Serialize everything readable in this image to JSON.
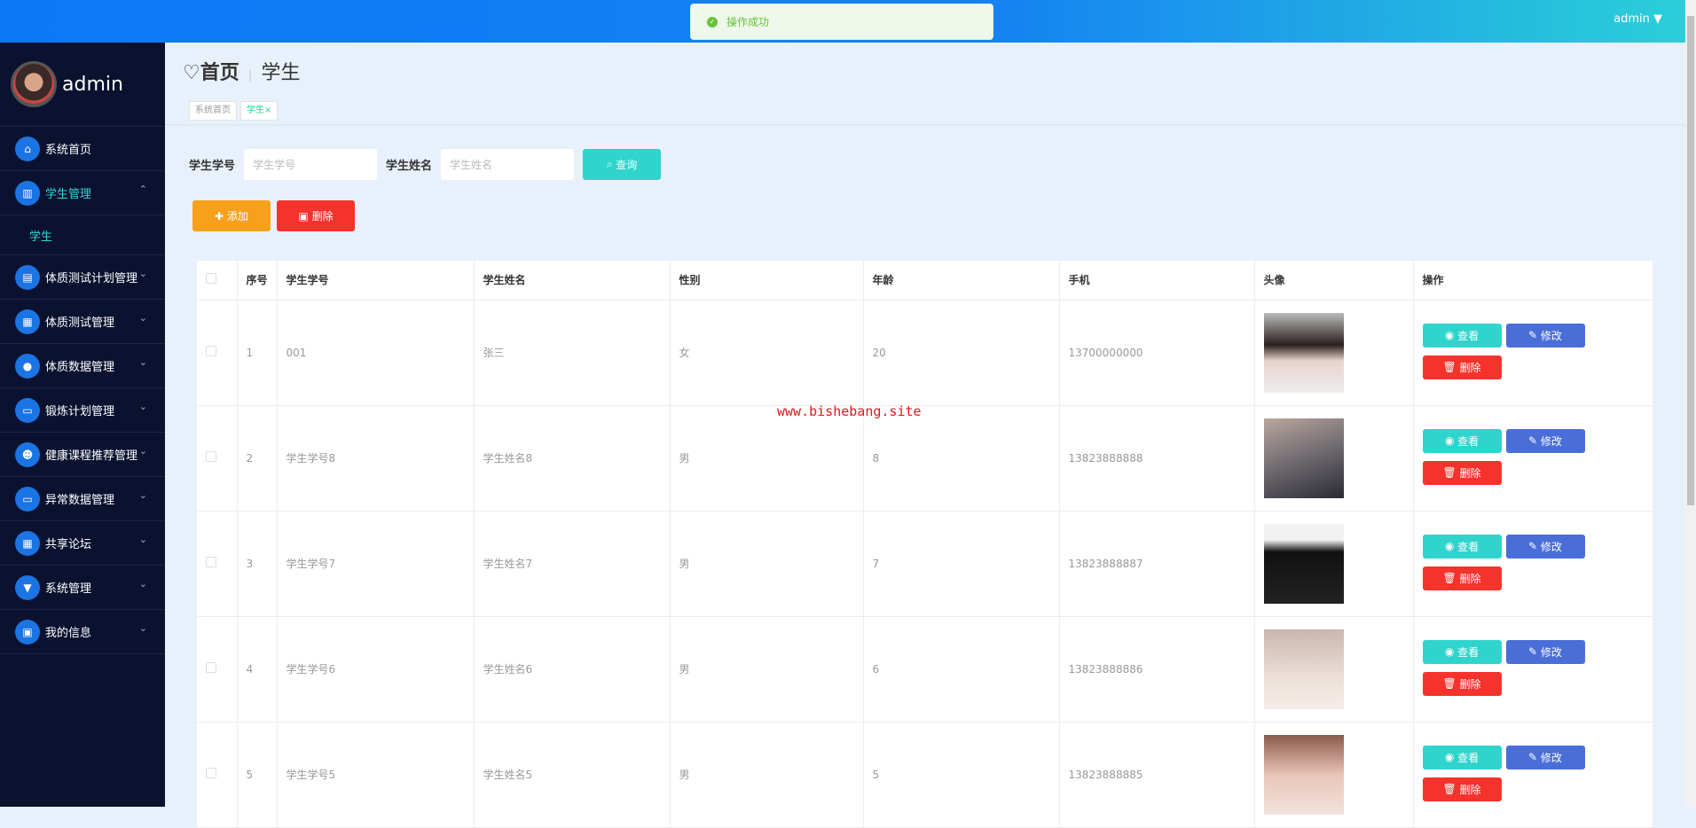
{
  "header": {
    "user": "admin",
    "toast": "操作成功"
  },
  "sidebar": {
    "username": "admin",
    "items": [
      {
        "label": "系统首页",
        "icon": "home-icon"
      },
      {
        "label": "学生管理",
        "icon": "book-icon",
        "expanded": true,
        "children": [
          "学生"
        ]
      },
      {
        "label": "体质测试计划管理",
        "icon": "clipboard-icon"
      },
      {
        "label": "体质测试管理",
        "icon": "grid-icon"
      },
      {
        "label": "体质数据管理",
        "icon": "bulb-icon"
      },
      {
        "label": "锻炼计划管理",
        "icon": "monitor-icon"
      },
      {
        "label": "健康课程推荐管理",
        "icon": "user-icon"
      },
      {
        "label": "异常数据管理",
        "icon": "monitor-icon"
      },
      {
        "label": "共享论坛",
        "icon": "grid-icon"
      },
      {
        "label": "系统管理",
        "icon": "settings-icon"
      },
      {
        "label": "我的信息",
        "icon": "card-icon"
      }
    ]
  },
  "page": {
    "home": "首页",
    "current": "学生",
    "tabs": [
      "系统首页",
      "学生"
    ]
  },
  "search": {
    "label1": "学生学号",
    "placeholder1": "学生学号",
    "label2": "学生姓名",
    "placeholder2": "学生姓名",
    "button": "查询"
  },
  "actions": {
    "add": "添加",
    "delete": "删除"
  },
  "table": {
    "headers": [
      "序号",
      "学生学号",
      "学生姓名",
      "性别",
      "年龄",
      "手机",
      "头像",
      "操作"
    ],
    "view": "查看",
    "edit": "修改",
    "delete": "删除",
    "rows": [
      {
        "no": "1",
        "id": "001",
        "name": "张三",
        "gender": "女",
        "age": "20",
        "phone": "13700000000"
      },
      {
        "no": "2",
        "id": "学生学号8",
        "name": "学生姓名8",
        "gender": "男",
        "age": "8",
        "phone": "13823888888"
      },
      {
        "no": "3",
        "id": "学生学号7",
        "name": "学生姓名7",
        "gender": "男",
        "age": "7",
        "phone": "13823888887"
      },
      {
        "no": "4",
        "id": "学生学号6",
        "name": "学生姓名6",
        "gender": "男",
        "age": "6",
        "phone": "13823888886"
      },
      {
        "no": "5",
        "id": "学生学号5",
        "name": "学生姓名5",
        "gender": "男",
        "age": "5",
        "phone": "13823888885"
      }
    ]
  },
  "watermark": "www.bishebang.site"
}
